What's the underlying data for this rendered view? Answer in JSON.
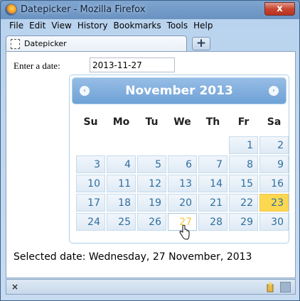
{
  "window": {
    "title": "Datepicker - Mozilla Firefox",
    "close_glyph": "x"
  },
  "menubar": {
    "items": [
      "File",
      "Edit",
      "View",
      "History",
      "Bookmarks",
      "Tools",
      "Help"
    ]
  },
  "tabs": {
    "active_label": "Datepicker",
    "new_tab_glyph": "+"
  },
  "page": {
    "date_label": "Enter a date:",
    "date_value": "2013-11-27",
    "selected_text": "Selected date: Wednesday, 27 November, 2013"
  },
  "datepicker": {
    "title": "November 2013",
    "prev_glyph": "‹",
    "next_glyph": "›",
    "weekdays": [
      "Su",
      "Mo",
      "Tu",
      "We",
      "Th",
      "Fr",
      "Sa"
    ],
    "weeks": [
      [
        "",
        "",
        "",
        "",
        "",
        "1",
        "2"
      ],
      [
        "3",
        "4",
        "5",
        "6",
        "7",
        "8",
        "9"
      ],
      [
        "10",
        "11",
        "12",
        "13",
        "14",
        "15",
        "16"
      ],
      [
        "17",
        "18",
        "19",
        "20",
        "21",
        "22",
        "23"
      ],
      [
        "24",
        "25",
        "26",
        "27",
        "28",
        "29",
        "30"
      ]
    ],
    "today": "23",
    "selected": "27",
    "colors": {
      "header": "#6ea1d6",
      "day_text": "#2e6e9e",
      "today_bg": "#fbd850"
    }
  },
  "statusbar": {
    "close_glyph": "×"
  }
}
